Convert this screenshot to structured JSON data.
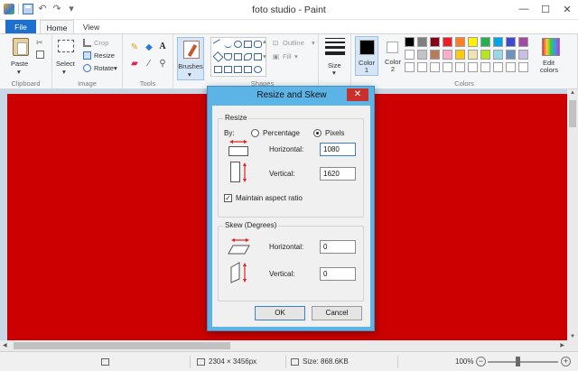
{
  "window": {
    "title": "foto studio - Paint",
    "minimize": "—",
    "maximize": "☐",
    "close": "✕"
  },
  "tabs": [
    {
      "label": "File"
    },
    {
      "label": "Home"
    },
    {
      "label": "View"
    }
  ],
  "ribbon": {
    "clipboard": {
      "paste": "Paste",
      "group": "Clipboard"
    },
    "image": {
      "select": "Select",
      "crop": "Crop",
      "resize": "Resize",
      "rotate": "Rotate",
      "group": "Image"
    },
    "tools": {
      "group": "Tools",
      "text_tool": "A"
    },
    "brushes": {
      "label": "Brushes"
    },
    "shapes": {
      "outline": "Outline",
      "fill": "Fill",
      "group": "Shapes"
    },
    "size": {
      "label": "Size"
    },
    "colors": {
      "color1": "Color\n1",
      "color1_a": "Color",
      "color1_b": "1",
      "color2_a": "Color",
      "color2_b": "2",
      "edit_a": "Edit",
      "edit_b": "colors",
      "group": "Colors",
      "color1_value": "#000000",
      "color2_value": "#ffffff"
    }
  },
  "palette": [
    "#000000",
    "#7f7f7f",
    "#880015",
    "#ed1c24",
    "#ff7f27",
    "#fff200",
    "#22b14c",
    "#00a2e8",
    "#3f48cc",
    "#a349a4",
    "#ffffff",
    "#c3c3c3",
    "#b97a57",
    "#ffaec9",
    "#ffc90e",
    "#efe4b0",
    "#b5e61d",
    "#99d9ea",
    "#7092be",
    "#c8bfe7",
    "#ffffff",
    "#ffffff",
    "#ffffff",
    "#ffffff",
    "#ffffff",
    "#ffffff",
    "#ffffff",
    "#ffffff",
    "#ffffff",
    "#ffffff"
  ],
  "canvas": {
    "color": "#cc0000"
  },
  "dialog": {
    "title": "Resize and Skew",
    "close": "✕",
    "resize": {
      "legend": "Resize",
      "by": "By:",
      "percentage": "Percentage",
      "pixels": "Pixels",
      "horizontal_label": "Horizontal:",
      "horizontal_value": "1080",
      "vertical_label": "Vertical:",
      "vertical_value": "1620",
      "maintain": "Maintain aspect ratio"
    },
    "skew": {
      "legend": "Skew (Degrees)",
      "horizontal_label": "Horizontal:",
      "horizontal_value": "0",
      "vertical_label": "Vertical:",
      "vertical_value": "0"
    },
    "ok": "OK",
    "cancel": "Cancel"
  },
  "status": {
    "dimensions": "2304 × 3456px",
    "size": "Size: 868.6KB",
    "zoom": "100%",
    "zoom_out": "−",
    "zoom_in": "+"
  }
}
